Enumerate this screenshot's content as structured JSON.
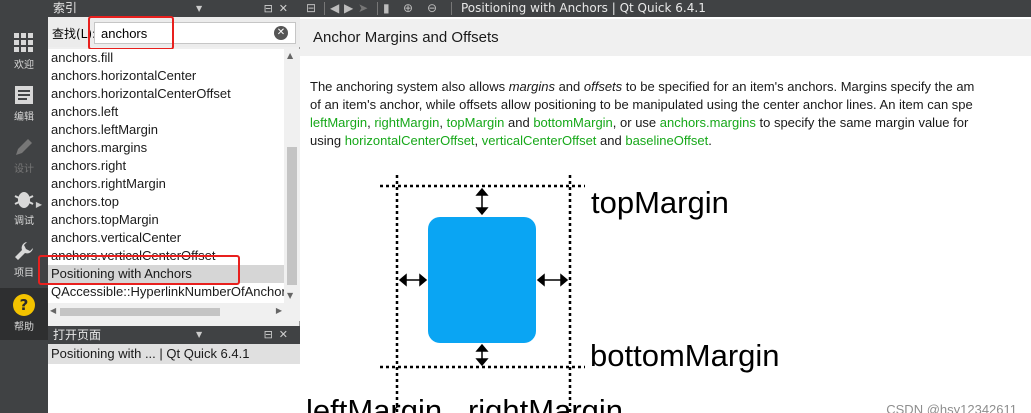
{
  "modebar": {
    "items": [
      {
        "label": "欢迎",
        "icon": "grid-icon"
      },
      {
        "label": "编辑",
        "icon": "document-icon"
      },
      {
        "label": "设计",
        "icon": "pen-icon"
      },
      {
        "label": "调试",
        "icon": "bug-icon"
      },
      {
        "label": "项目",
        "icon": "wrench-icon"
      },
      {
        "label": "帮助",
        "icon": "help-icon"
      }
    ]
  },
  "index_panel": {
    "title": "索引",
    "find_label": "查找(L):",
    "search_value": "anchors",
    "items": [
      "anchors.fill",
      "anchors.horizontalCenter",
      "anchors.horizontalCenterOffset",
      "anchors.left",
      "anchors.leftMargin",
      "anchors.margins",
      "anchors.right",
      "anchors.rightMargin",
      "anchors.top",
      "anchors.topMargin",
      "anchors.verticalCenter",
      "anchors.verticalCenterOffset",
      "Positioning with Anchors",
      "QAccessible::HyperlinkNumberOfAnchors"
    ],
    "selected_index": 12
  },
  "open_pages_panel": {
    "title": "打开页面",
    "items": [
      "Positioning with ... | Qt Quick 6.4.1"
    ]
  },
  "toolbar": {
    "title": "Positioning with Anchors | Qt Quick 6.4.1"
  },
  "doc": {
    "heading": "Anchor Margins and Offsets",
    "para": {
      "l1_a": "The anchoring system also allows ",
      "l1_margins": "margins",
      "l1_b": " and ",
      "l1_offsets": "offsets",
      "l1_c": " to be specified for an item's anchors. Margins specify the am",
      "l2": "of an item's anchor, while offsets allow positioning to be manipulated using the center anchor lines. An item can spe",
      "l3_link1": "leftMargin",
      "l3_sep1": ", ",
      "l3_link2": "rightMargin",
      "l3_sep2": ", ",
      "l3_link3": "topMargin",
      "l3_and": " and ",
      "l3_link4": "bottomMargin",
      "l3_mid": ", or use ",
      "l3_link5": "anchors.margins",
      "l3_end": " to specify the same margin value for",
      "l4_a": "using ",
      "l4_link1": "horizontalCenterOffset",
      "l4_sep": ", ",
      "l4_link2": "verticalCenterOffset",
      "l4_and": " and ",
      "l4_link3": "baselineOffset",
      "l4_end": "."
    },
    "diagram": {
      "top_label": "topMargin",
      "bottom_label": "bottomMargin",
      "bottom_text": "leftMargin   rightMargin",
      "box_color": "#0aa5f3"
    }
  },
  "watermark": "CSDN @hsy12342611",
  "colors": {
    "link": "#17a81a",
    "highlight_box": "#e8201e"
  }
}
